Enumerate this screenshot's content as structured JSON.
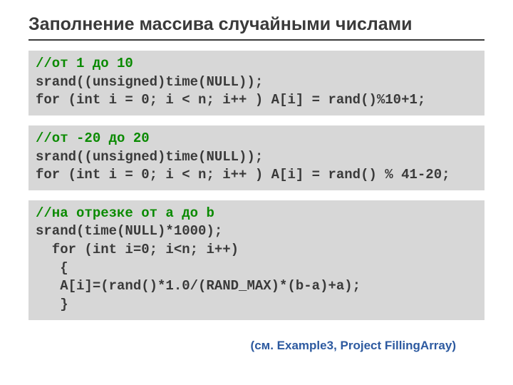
{
  "title": "Заполнение массива случайными числами",
  "blocks": [
    {
      "comment": "//от 1 до 10",
      "lines": [
        "srand((unsigned)time(NULL));",
        "for (int i = 0; i < n; i++ ) A[i] = rand()%10+1;"
      ]
    },
    {
      "comment": "//от -20 до 20",
      "lines": [
        "srand((unsigned)time(NULL));",
        "for (int i = 0; i < n; i++ ) A[i] = rand() % 41-20;"
      ]
    },
    {
      "comment": "//на отрезке от a до b",
      "lines": [
        "srand(time(NULL)*1000);",
        "  for (int i=0; i<n; i++)",
        "   {",
        "   A[i]=(rand()*1.0/(RAND_MAX)*(b-a)+a);",
        "   }"
      ]
    }
  ],
  "footnote": "(см. Example3, Project FillingArray)"
}
